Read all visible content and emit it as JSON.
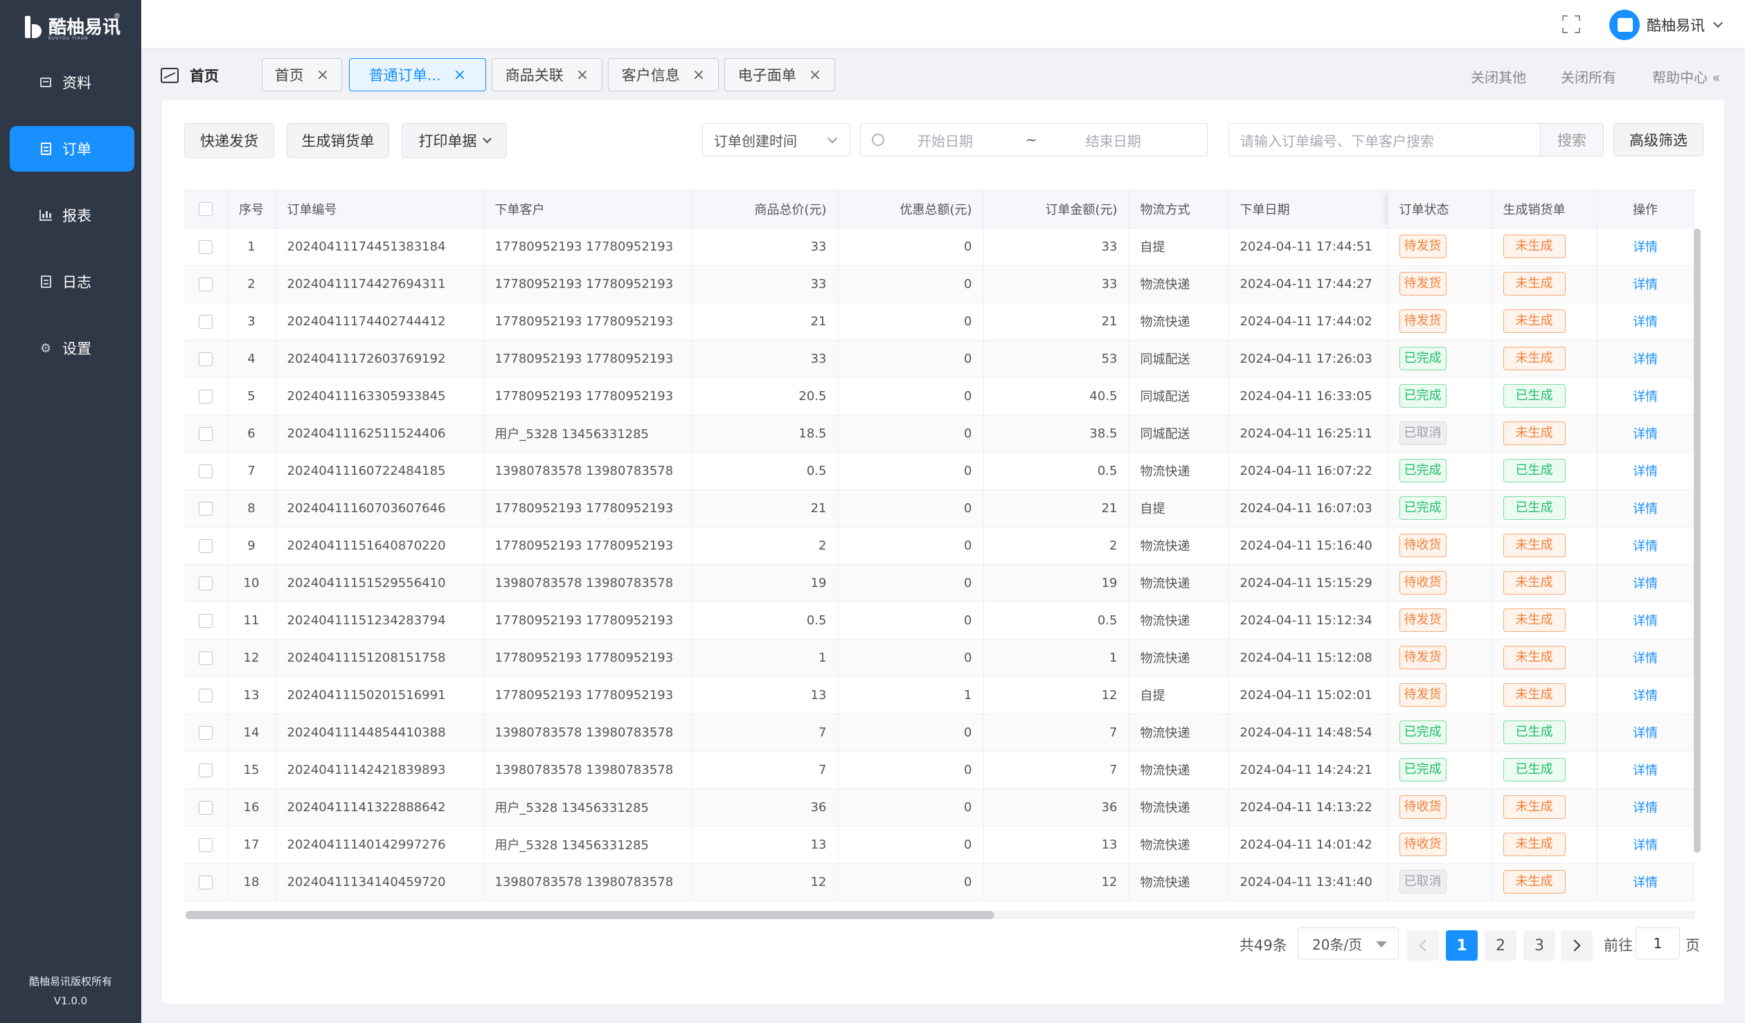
{
  "app": {
    "logo_text": "酷柚易讯",
    "logo_sub": "KUUYOU YIXUN",
    "copyright": "酷柚易讯版权所有",
    "version": "V1.0.0"
  },
  "sidebar": {
    "items": [
      {
        "label": "资料",
        "icon": "box-icon"
      },
      {
        "label": "订单",
        "icon": "document-icon"
      },
      {
        "label": "报表",
        "icon": "bar-chart-icon"
      },
      {
        "label": "日志",
        "icon": "log-icon"
      },
      {
        "label": "设置",
        "icon": "gear-icon"
      }
    ]
  },
  "header": {
    "username": "酷柚易讯"
  },
  "tabs": {
    "home_title": "首页",
    "items": [
      {
        "label": "首页"
      },
      {
        "label": "普通订单..."
      },
      {
        "label": "商品关联"
      },
      {
        "label": "客户信息"
      },
      {
        "label": "电子面单"
      }
    ],
    "close_others": "关闭其他",
    "close_all": "关闭所有",
    "help": "帮助中心 «"
  },
  "toolbar": {
    "express_ship": "快递发货",
    "gen_sales": "生成销货单",
    "print": "打印单据",
    "date_field": "订单创建时间",
    "start_placeholder": "开始日期",
    "range_sep": "~",
    "end_placeholder": "结束日期",
    "search_placeholder": "请输入订单编号、下单客户搜索",
    "search_button": "搜索",
    "advanced": "高级筛选"
  },
  "table": {
    "headers": [
      "序号",
      "订单编号",
      "下单客户",
      "商品总价(元)",
      "优惠总额(元)",
      "订单金额(元)",
      "物流方式",
      "下单日期",
      "订单状态",
      "生成销货单",
      "操作"
    ],
    "detail_label": "详情",
    "rows": [
      {
        "no": "1",
        "order": "20240411174451383184",
        "customer": "17780952193   17780952193",
        "total": "33",
        "discount": "0",
        "amount": "33",
        "logistics": "自提",
        "date": "2024-04-11 17:44:51",
        "status": "待发货",
        "status_type": "orange",
        "sales": "未生成",
        "sales_type": "orange"
      },
      {
        "no": "2",
        "order": "20240411174427694311",
        "customer": "17780952193   17780952193",
        "total": "33",
        "discount": "0",
        "amount": "33",
        "logistics": "物流快递",
        "date": "2024-04-11 17:44:27",
        "status": "待发货",
        "status_type": "orange",
        "sales": "未生成",
        "sales_type": "orange"
      },
      {
        "no": "3",
        "order": "20240411174402744412",
        "customer": "17780952193   17780952193",
        "total": "21",
        "discount": "0",
        "amount": "21",
        "logistics": "物流快递",
        "date": "2024-04-11 17:44:02",
        "status": "待发货",
        "status_type": "orange",
        "sales": "未生成",
        "sales_type": "orange"
      },
      {
        "no": "4",
        "order": "20240411172603769192",
        "customer": "17780952193   17780952193",
        "total": "33",
        "discount": "0",
        "amount": "53",
        "logistics": "同城配送",
        "date": "2024-04-11 17:26:03",
        "status": "已完成",
        "status_type": "green",
        "sales": "未生成",
        "sales_type": "orange"
      },
      {
        "no": "5",
        "order": "20240411163305933845",
        "customer": "17780952193   17780952193",
        "total": "20.5",
        "discount": "0",
        "amount": "40.5",
        "logistics": "同城配送",
        "date": "2024-04-11 16:33:05",
        "status": "已完成",
        "status_type": "green",
        "sales": "已生成",
        "sales_type": "green"
      },
      {
        "no": "6",
        "order": "20240411162511524406",
        "customer": "用户_5328   13456331285",
        "total": "18.5",
        "discount": "0",
        "amount": "38.5",
        "logistics": "同城配送",
        "date": "2024-04-11 16:25:11",
        "status": "已取消",
        "status_type": "gray",
        "sales": "未生成",
        "sales_type": "orange"
      },
      {
        "no": "7",
        "order": "20240411160722484185",
        "customer": "13980783578   13980783578",
        "total": "0.5",
        "discount": "0",
        "amount": "0.5",
        "logistics": "物流快递",
        "date": "2024-04-11 16:07:22",
        "status": "已完成",
        "status_type": "green",
        "sales": "已生成",
        "sales_type": "green"
      },
      {
        "no": "8",
        "order": "20240411160703607646",
        "customer": "17780952193   17780952193",
        "total": "21",
        "discount": "0",
        "amount": "21",
        "logistics": "自提",
        "date": "2024-04-11 16:07:03",
        "status": "已完成",
        "status_type": "green",
        "sales": "已生成",
        "sales_type": "green"
      },
      {
        "no": "9",
        "order": "20240411151640870220",
        "customer": "17780952193   17780952193",
        "total": "2",
        "discount": "0",
        "amount": "2",
        "logistics": "物流快递",
        "date": "2024-04-11 15:16:40",
        "status": "待收货",
        "status_type": "orange",
        "sales": "未生成",
        "sales_type": "orange"
      },
      {
        "no": "10",
        "order": "20240411151529556410",
        "customer": "13980783578   13980783578",
        "total": "19",
        "discount": "0",
        "amount": "19",
        "logistics": "物流快递",
        "date": "2024-04-11 15:15:29",
        "status": "待收货",
        "status_type": "orange",
        "sales": "未生成",
        "sales_type": "orange"
      },
      {
        "no": "11",
        "order": "20240411151234283794",
        "customer": "17780952193   17780952193",
        "total": "0.5",
        "discount": "0",
        "amount": "0.5",
        "logistics": "物流快递",
        "date": "2024-04-11 15:12:34",
        "status": "待发货",
        "status_type": "orange",
        "sales": "未生成",
        "sales_type": "orange"
      },
      {
        "no": "12",
        "order": "20240411151208151758",
        "customer": "17780952193   17780952193",
        "total": "1",
        "discount": "0",
        "amount": "1",
        "logistics": "物流快递",
        "date": "2024-04-11 15:12:08",
        "status": "待发货",
        "status_type": "orange",
        "sales": "未生成",
        "sales_type": "orange"
      },
      {
        "no": "13",
        "order": "20240411150201516991",
        "customer": "17780952193   17780952193",
        "total": "13",
        "discount": "1",
        "amount": "12",
        "logistics": "自提",
        "date": "2024-04-11 15:02:01",
        "status": "待发货",
        "status_type": "orange",
        "sales": "未生成",
        "sales_type": "orange"
      },
      {
        "no": "14",
        "order": "20240411144854410388",
        "customer": "13980783578   13980783578",
        "total": "7",
        "discount": "0",
        "amount": "7",
        "logistics": "物流快递",
        "date": "2024-04-11 14:48:54",
        "status": "已完成",
        "status_type": "green",
        "sales": "已生成",
        "sales_type": "green"
      },
      {
        "no": "15",
        "order": "20240411142421839893",
        "customer": "13980783578   13980783578",
        "total": "7",
        "discount": "0",
        "amount": "7",
        "logistics": "物流快递",
        "date": "2024-04-11 14:24:21",
        "status": "已完成",
        "status_type": "green",
        "sales": "已生成",
        "sales_type": "green"
      },
      {
        "no": "16",
        "order": "20240411141322888642",
        "customer": "用户_5328   13456331285",
        "total": "36",
        "discount": "0",
        "amount": "36",
        "logistics": "物流快递",
        "date": "2024-04-11 14:13:22",
        "status": "待收货",
        "status_type": "orange",
        "sales": "未生成",
        "sales_type": "orange"
      },
      {
        "no": "17",
        "order": "20240411140142997276",
        "customer": "用户_5328   13456331285",
        "total": "13",
        "discount": "0",
        "amount": "13",
        "logistics": "物流快递",
        "date": "2024-04-11 14:01:42",
        "status": "待收货",
        "status_type": "orange",
        "sales": "未生成",
        "sales_type": "orange"
      },
      {
        "no": "18",
        "order": "20240411134140459720",
        "customer": "13980783578   13980783578",
        "total": "12",
        "discount": "0",
        "amount": "12",
        "logistics": "物流快递",
        "date": "2024-04-11 13:41:40",
        "status": "已取消",
        "status_type": "gray",
        "sales": "未生成",
        "sales_type": "orange"
      }
    ]
  },
  "pagination": {
    "total": "共49条",
    "page_size": "20条/页",
    "pages": [
      "1",
      "2",
      "3"
    ],
    "goto_label": "前往",
    "goto_value": "1",
    "page_unit": "页"
  },
  "colors": {
    "primary": "#1890ff",
    "sidebar": "#2f3847",
    "orange": "#f3803b",
    "green": "#1fbe67"
  }
}
